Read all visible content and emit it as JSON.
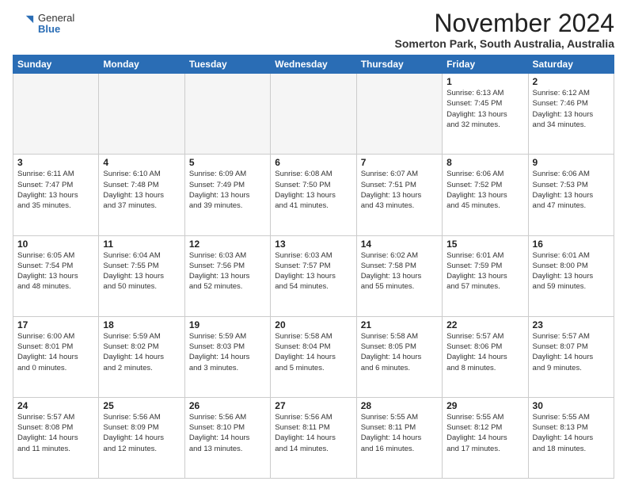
{
  "header": {
    "logo_general": "General",
    "logo_blue": "Blue",
    "month_title": "November 2024",
    "location": "Somerton Park, South Australia, Australia"
  },
  "calendar": {
    "days_of_week": [
      "Sunday",
      "Monday",
      "Tuesday",
      "Wednesday",
      "Thursday",
      "Friday",
      "Saturday"
    ],
    "weeks": [
      [
        {
          "day": "",
          "info": ""
        },
        {
          "day": "",
          "info": ""
        },
        {
          "day": "",
          "info": ""
        },
        {
          "day": "",
          "info": ""
        },
        {
          "day": "",
          "info": ""
        },
        {
          "day": "1",
          "info": "Sunrise: 6:13 AM\nSunset: 7:45 PM\nDaylight: 13 hours\nand 32 minutes."
        },
        {
          "day": "2",
          "info": "Sunrise: 6:12 AM\nSunset: 7:46 PM\nDaylight: 13 hours\nand 34 minutes."
        }
      ],
      [
        {
          "day": "3",
          "info": "Sunrise: 6:11 AM\nSunset: 7:47 PM\nDaylight: 13 hours\nand 35 minutes."
        },
        {
          "day": "4",
          "info": "Sunrise: 6:10 AM\nSunset: 7:48 PM\nDaylight: 13 hours\nand 37 minutes."
        },
        {
          "day": "5",
          "info": "Sunrise: 6:09 AM\nSunset: 7:49 PM\nDaylight: 13 hours\nand 39 minutes."
        },
        {
          "day": "6",
          "info": "Sunrise: 6:08 AM\nSunset: 7:50 PM\nDaylight: 13 hours\nand 41 minutes."
        },
        {
          "day": "7",
          "info": "Sunrise: 6:07 AM\nSunset: 7:51 PM\nDaylight: 13 hours\nand 43 minutes."
        },
        {
          "day": "8",
          "info": "Sunrise: 6:06 AM\nSunset: 7:52 PM\nDaylight: 13 hours\nand 45 minutes."
        },
        {
          "day": "9",
          "info": "Sunrise: 6:06 AM\nSunset: 7:53 PM\nDaylight: 13 hours\nand 47 minutes."
        }
      ],
      [
        {
          "day": "10",
          "info": "Sunrise: 6:05 AM\nSunset: 7:54 PM\nDaylight: 13 hours\nand 48 minutes."
        },
        {
          "day": "11",
          "info": "Sunrise: 6:04 AM\nSunset: 7:55 PM\nDaylight: 13 hours\nand 50 minutes."
        },
        {
          "day": "12",
          "info": "Sunrise: 6:03 AM\nSunset: 7:56 PM\nDaylight: 13 hours\nand 52 minutes."
        },
        {
          "day": "13",
          "info": "Sunrise: 6:03 AM\nSunset: 7:57 PM\nDaylight: 13 hours\nand 54 minutes."
        },
        {
          "day": "14",
          "info": "Sunrise: 6:02 AM\nSunset: 7:58 PM\nDaylight: 13 hours\nand 55 minutes."
        },
        {
          "day": "15",
          "info": "Sunrise: 6:01 AM\nSunset: 7:59 PM\nDaylight: 13 hours\nand 57 minutes."
        },
        {
          "day": "16",
          "info": "Sunrise: 6:01 AM\nSunset: 8:00 PM\nDaylight: 13 hours\nand 59 minutes."
        }
      ],
      [
        {
          "day": "17",
          "info": "Sunrise: 6:00 AM\nSunset: 8:01 PM\nDaylight: 14 hours\nand 0 minutes."
        },
        {
          "day": "18",
          "info": "Sunrise: 5:59 AM\nSunset: 8:02 PM\nDaylight: 14 hours\nand 2 minutes."
        },
        {
          "day": "19",
          "info": "Sunrise: 5:59 AM\nSunset: 8:03 PM\nDaylight: 14 hours\nand 3 minutes."
        },
        {
          "day": "20",
          "info": "Sunrise: 5:58 AM\nSunset: 8:04 PM\nDaylight: 14 hours\nand 5 minutes."
        },
        {
          "day": "21",
          "info": "Sunrise: 5:58 AM\nSunset: 8:05 PM\nDaylight: 14 hours\nand 6 minutes."
        },
        {
          "day": "22",
          "info": "Sunrise: 5:57 AM\nSunset: 8:06 PM\nDaylight: 14 hours\nand 8 minutes."
        },
        {
          "day": "23",
          "info": "Sunrise: 5:57 AM\nSunset: 8:07 PM\nDaylight: 14 hours\nand 9 minutes."
        }
      ],
      [
        {
          "day": "24",
          "info": "Sunrise: 5:57 AM\nSunset: 8:08 PM\nDaylight: 14 hours\nand 11 minutes."
        },
        {
          "day": "25",
          "info": "Sunrise: 5:56 AM\nSunset: 8:09 PM\nDaylight: 14 hours\nand 12 minutes."
        },
        {
          "day": "26",
          "info": "Sunrise: 5:56 AM\nSunset: 8:10 PM\nDaylight: 14 hours\nand 13 minutes."
        },
        {
          "day": "27",
          "info": "Sunrise: 5:56 AM\nSunset: 8:11 PM\nDaylight: 14 hours\nand 14 minutes."
        },
        {
          "day": "28",
          "info": "Sunrise: 5:55 AM\nSunset: 8:11 PM\nDaylight: 14 hours\nand 16 minutes."
        },
        {
          "day": "29",
          "info": "Sunrise: 5:55 AM\nSunset: 8:12 PM\nDaylight: 14 hours\nand 17 minutes."
        },
        {
          "day": "30",
          "info": "Sunrise: 5:55 AM\nSunset: 8:13 PM\nDaylight: 14 hours\nand 18 minutes."
        }
      ]
    ]
  }
}
